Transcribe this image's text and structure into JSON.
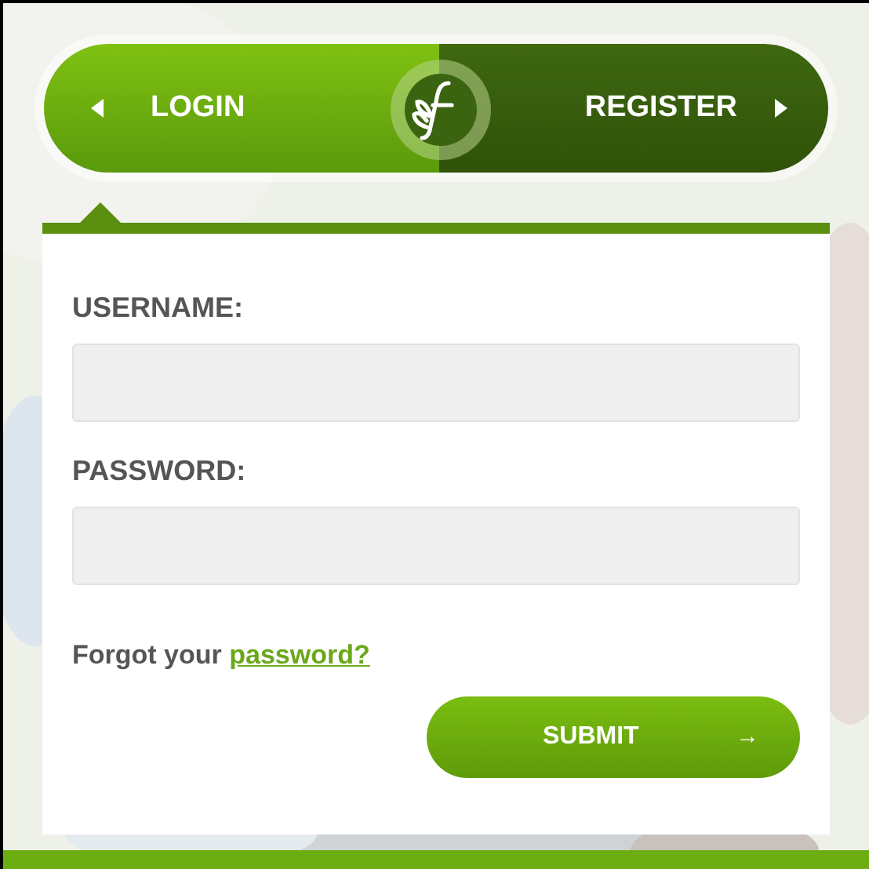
{
  "tabs": [
    {
      "label": "LOGIN",
      "selected": true
    },
    {
      "label": "REGISTER",
      "selected": false
    }
  ],
  "fields": [
    {
      "label": "USERNAME:"
    },
    {
      "label": "PASSWORD:"
    }
  ],
  "forgot": {
    "text": "Forgot your",
    "link": "password?"
  },
  "submit": {
    "label": "SUBMIT",
    "arrow": "→"
  }
}
